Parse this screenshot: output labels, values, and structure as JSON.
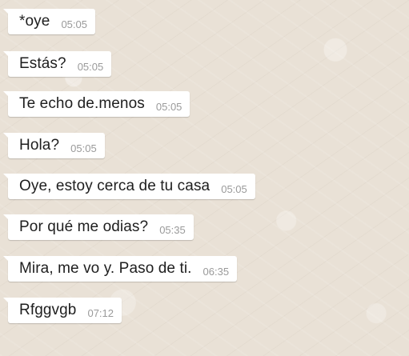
{
  "messages": [
    {
      "text": "*oye",
      "time": "05:05"
    },
    {
      "text": "Estás?",
      "time": "05:05"
    },
    {
      "text": "Te echo de.menos",
      "time": "05:05"
    },
    {
      "text": "Hola?",
      "time": "05:05"
    },
    {
      "text": "Oye, estoy cerca de tu casa",
      "time": "05:05"
    },
    {
      "text": "Por qué me odias?",
      "time": "05:35"
    },
    {
      "text": "Mira, me vo y.  Paso de ti.",
      "time": "06:35"
    },
    {
      "text": "Rfggvgb",
      "time": "07:12"
    }
  ]
}
